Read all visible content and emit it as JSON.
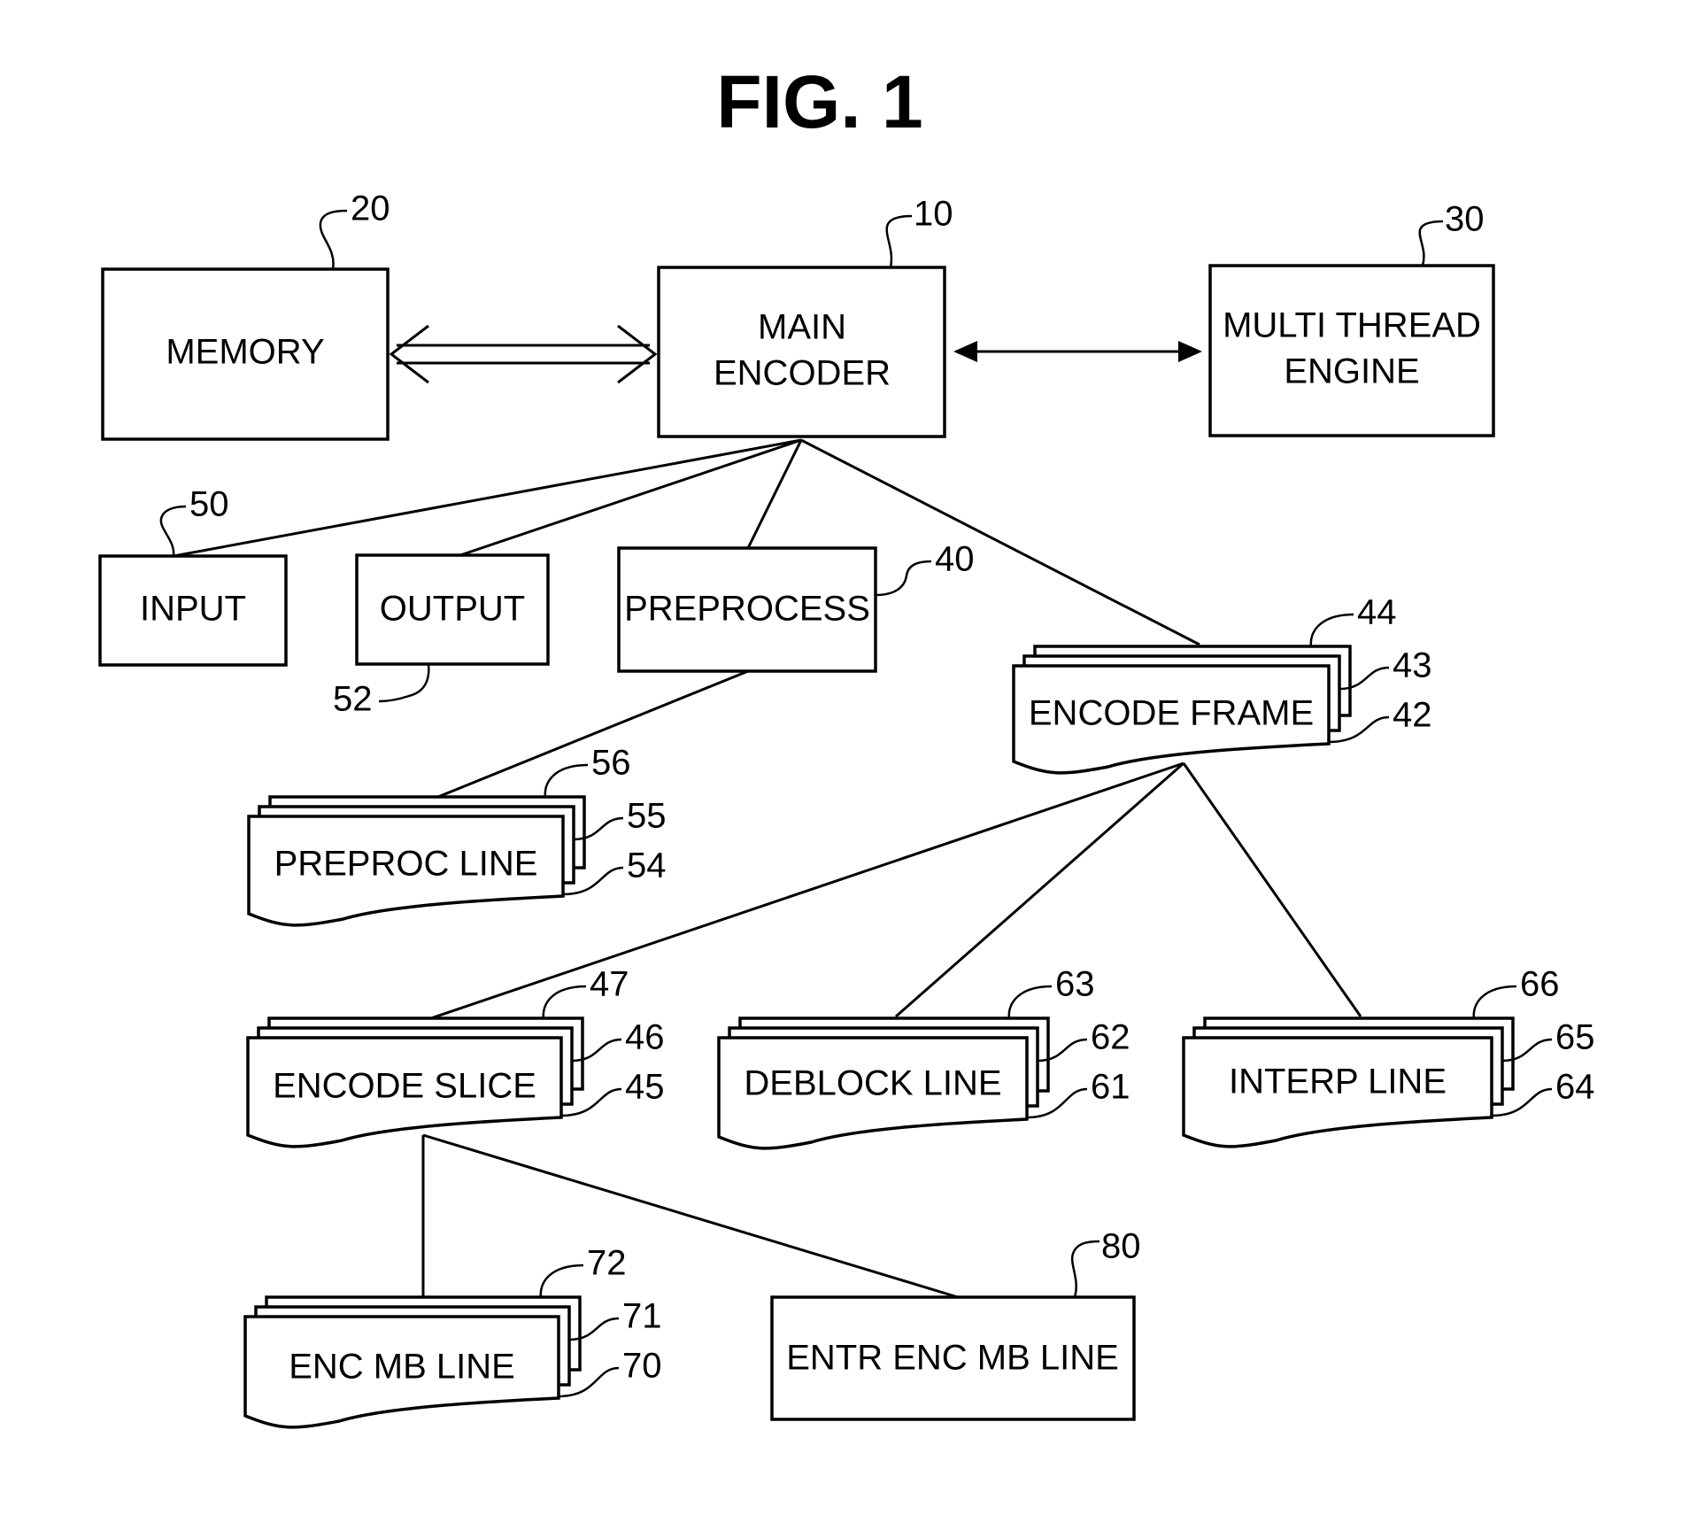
{
  "figure": {
    "title": "FIG. 1"
  },
  "blocks": {
    "memory": {
      "label": "MEMORY",
      "ref": "20"
    },
    "main_encoder": {
      "label_line1": "MAIN",
      "label_line2": "ENCODER",
      "ref": "10"
    },
    "multi_thread_engine": {
      "label_line1": "MULTI THREAD",
      "label_line2": "ENGINE",
      "ref": "30"
    },
    "input": {
      "label": "INPUT",
      "ref": "50"
    },
    "output": {
      "label": "OUTPUT",
      "ref": "52"
    },
    "preprocess": {
      "label": "PREPROCESS",
      "ref": "40"
    },
    "encode_frame": {
      "label": "ENCODE FRAME",
      "refs": [
        "42",
        "43",
        "44"
      ]
    },
    "preproc_line": {
      "label": "PREPROC LINE",
      "refs": [
        "54",
        "55",
        "56"
      ]
    },
    "encode_slice": {
      "label": "ENCODE SLICE",
      "refs": [
        "45",
        "46",
        "47"
      ]
    },
    "deblock_line": {
      "label": "DEBLOCK LINE",
      "refs": [
        "61",
        "62",
        "63"
      ]
    },
    "interp_line": {
      "label": "INTERP LINE",
      "refs": [
        "64",
        "65",
        "66"
      ]
    },
    "enc_mb_line": {
      "label": "ENC MB LINE",
      "refs": [
        "70",
        "71",
        "72"
      ]
    },
    "entr_enc_mb_line": {
      "label": "ENTR ENC MB LINE",
      "ref": "80"
    }
  },
  "connections": [
    {
      "from": "memory",
      "to": "main_encoder",
      "type": "bidirectional-hollow"
    },
    {
      "from": "main_encoder",
      "to": "multi_thread_engine",
      "type": "bidirectional-solid"
    },
    {
      "from": "main_encoder",
      "to": "input"
    },
    {
      "from": "main_encoder",
      "to": "output"
    },
    {
      "from": "main_encoder",
      "to": "preprocess"
    },
    {
      "from": "main_encoder",
      "to": "encode_frame"
    },
    {
      "from": "preprocess",
      "to": "preproc_line"
    },
    {
      "from": "encode_frame",
      "to": "encode_slice"
    },
    {
      "from": "encode_frame",
      "to": "deblock_line"
    },
    {
      "from": "encode_frame",
      "to": "interp_line"
    },
    {
      "from": "encode_slice",
      "to": "enc_mb_line"
    },
    {
      "from": "encode_slice",
      "to": "entr_enc_mb_line"
    }
  ]
}
